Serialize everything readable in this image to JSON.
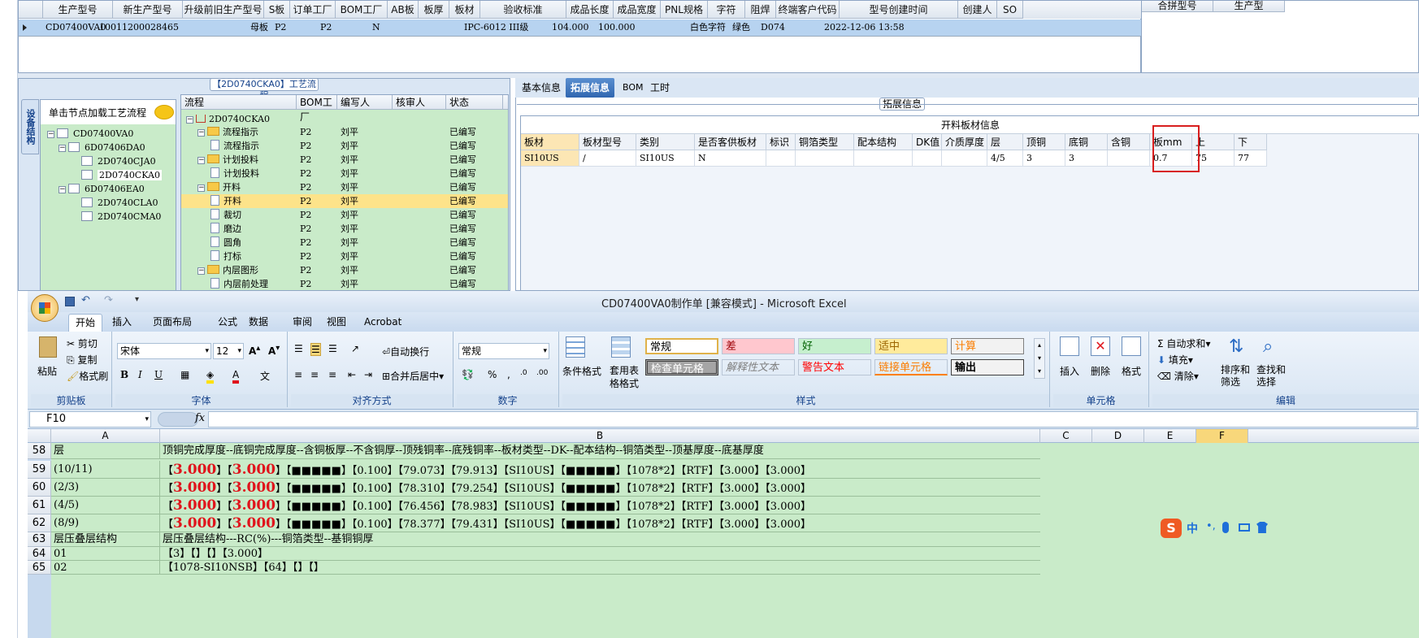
{
  "top_grid": {
    "headers": [
      "生产型号",
      "新生产型号",
      "升级前旧生产型号",
      "S板",
      "订单工厂",
      "BOM工厂",
      "AB板",
      "板厚",
      "板材",
      "验收标准",
      "成品长度",
      "成品宽度",
      "PNL规格",
      "字符",
      "阻焊",
      "终端客户代码",
      "型号创建时间",
      "创建人",
      "SO"
    ],
    "row": [
      "CD07400VA0",
      "10011200028465",
      "",
      "母板",
      "P2",
      "P2",
      "N",
      "",
      "",
      "IPC-6012 III级",
      "104.000",
      "100.000",
      "",
      "白色字符",
      "绿色",
      "D074",
      "2022-12-06 13:58",
      "",
      ""
    ],
    "right_headers": [
      "合拼型号",
      "生产型"
    ]
  },
  "process_title": "【2D0740CKA0】工艺流程",
  "side_tab": "设备结构",
  "left_tree": {
    "hint": "单击节点加载工艺流程",
    "nodes": [
      "CD07400VA0",
      "6D07406DA0",
      "2D0740CJA0",
      "2D0740CKA0",
      "6D07406EA0",
      "2D0740CLA0",
      "2D0740CMA0"
    ]
  },
  "flow_grid": {
    "headers": [
      "流程",
      "BOM工厂",
      "编写人",
      "核审人",
      "状态"
    ],
    "root": "2D0740CKA0",
    "rows": [
      {
        "name": "流程指示",
        "bom": "P2",
        "writer": "刘平",
        "status": "已编写",
        "folder": true
      },
      {
        "name": "流程指示",
        "bom": "P2",
        "writer": "刘平",
        "status": "已编写",
        "folder": false
      },
      {
        "name": "计划投料",
        "bom": "P2",
        "writer": "刘平",
        "status": "已编写",
        "folder": true
      },
      {
        "name": "计划投料",
        "bom": "P2",
        "writer": "刘平",
        "status": "已编写",
        "folder": false
      },
      {
        "name": "开料",
        "bom": "P2",
        "writer": "刘平",
        "status": "已编写",
        "folder": true
      },
      {
        "name": "开料",
        "bom": "P2",
        "writer": "刘平",
        "status": "已编写",
        "folder": false
      },
      {
        "name": "裁切",
        "bom": "P2",
        "writer": "刘平",
        "status": "已编写",
        "folder": false
      },
      {
        "name": "磨边",
        "bom": "P2",
        "writer": "刘平",
        "status": "已编写",
        "folder": false
      },
      {
        "name": "圆角",
        "bom": "P2",
        "writer": "刘平",
        "status": "已编写",
        "folder": false
      },
      {
        "name": "打标",
        "bom": "P2",
        "writer": "刘平",
        "status": "已编写",
        "folder": false
      },
      {
        "name": "内层图形",
        "bom": "P2",
        "writer": "刘平",
        "status": "已编写",
        "folder": true
      },
      {
        "name": "内层前处理",
        "bom": "P2",
        "writer": "刘平",
        "status": "已编写",
        "folder": false
      }
    ]
  },
  "right_tabs": [
    "基本信息",
    "拓展信息",
    "BOM",
    "工时"
  ],
  "ext_label": "拓展信息",
  "material_title": "开料板材信息",
  "material_headers": [
    "板材",
    "板材型号",
    "类别",
    "是否客供板材",
    "标识",
    "铜箔类型",
    "配本结构",
    "DK值",
    "介质厚度",
    "层",
    "顶铜",
    "底铜",
    "含铜mm",
    "板mm",
    "上",
    "下"
  ],
  "material_row": [
    "SI10US",
    "/",
    "SI10US",
    "N",
    "",
    "",
    "",
    "",
    "",
    "4/5",
    "3",
    "3",
    "",
    "0.7",
    "75",
    "77"
  ],
  "excel": {
    "title": "CD07400VA0制作单 [兼容模式] - Microsoft Excel",
    "tabs": [
      "开始",
      "插入",
      "页面布局",
      "公式",
      "数据",
      "审阅",
      "视图",
      "Acrobat"
    ],
    "clipboard": {
      "paste": "粘贴",
      "cut": "剪切",
      "copy": "复制",
      "painter": "格式刷",
      "label": "剪贴板"
    },
    "font": {
      "name": "宋体",
      "size": "12",
      "label": "字体"
    },
    "align": {
      "wrap": "自动换行",
      "merge": "合并后居中",
      "label": "对齐方式"
    },
    "number": {
      "format": "常规",
      "label": "数字"
    },
    "styles_label": "样式",
    "cond_format": "条件格式",
    "table_format": "套用表格格式",
    "styles": [
      "常规",
      "差",
      "好",
      "适中",
      "计算",
      "检查单元格",
      "解释性文本",
      "警告文本",
      "链接单元格",
      "输出"
    ],
    "cells": {
      "insert": "插入",
      "delete": "删除",
      "format": "格式",
      "label": "单元格"
    },
    "editing": {
      "sum": "自动求和",
      "fill": "填充",
      "clear": "清除",
      "sort": "排序和筛选",
      "find": "查找和选择",
      "label": "编辑"
    },
    "name_box": "F10",
    "columns": [
      "A",
      "B",
      "C",
      "D",
      "E",
      "F"
    ],
    "rows": [
      {
        "num": "58",
        "a": "层",
        "b": "顶铜完成厚度--底铜完成厚度--含铜板厚--不含铜厚--顶残铜率--底残铜率--板材类型--DK--配本结构--铜箔类型--顶基厚度--底基厚度",
        "red": false
      },
      {
        "num": "59",
        "a": "(10/11)",
        "b1": "【",
        "r1": "3.000",
        "b2": "】【",
        "r2": "3.000",
        "b3": "】【■■■■■】【0.100】【79.073】【79.913】【SI10US】【■■■■■】【1078*2】【RTF】【3.000】【3.000】",
        "red": true
      },
      {
        "num": "60",
        "a": "(2/3)",
        "b1": "【",
        "r1": "3.000",
        "b2": "】【",
        "r2": "3.000",
        "b3": "】【■■■■■】【0.100】【78.310】【79.254】【SI10US】【■■■■■】【1078*2】【RTF】【3.000】【3.000】",
        "red": true
      },
      {
        "num": "61",
        "a": "(4/5)",
        "b1": "【",
        "r1": "3.000",
        "b2": "】【",
        "r2": "3.000",
        "b3": "】【■■■■■】【0.100】【76.456】【78.983】【SI10US】【■■■■■】【1078*2】【RTF】【3.000】【3.000】",
        "red": true
      },
      {
        "num": "62",
        "a": "(8/9)",
        "b1": "【",
        "r1": "3.000",
        "b2": "】【",
        "r2": "3.000",
        "b3": "】【■■■■■】【0.100】【78.377】【79.431】【SI10US】【■■■■■】【1078*2】【RTF】【3.000】【3.000】",
        "red": true
      },
      {
        "num": "63",
        "a": "层压叠层结构",
        "b": "层压叠层结构---RC(%)---铜箔类型--基铜铜厚",
        "red": false
      },
      {
        "num": "64",
        "a": "01",
        "b": "【3】【】【】【3.000】",
        "red": false
      },
      {
        "num": "65",
        "a": "02",
        "b": "【1078-SI10NSB】【64】【】【】",
        "red": false
      }
    ],
    "ime": "中"
  }
}
